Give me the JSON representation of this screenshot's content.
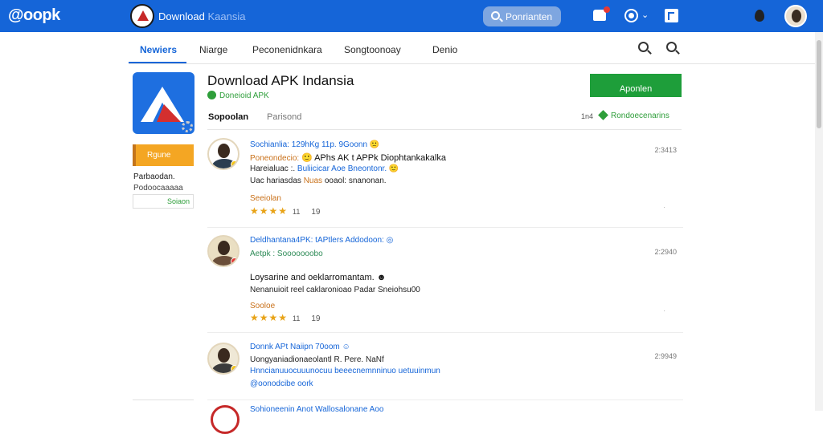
{
  "topbar": {
    "logo": "@oopk",
    "title": "Download",
    "title_faint": "Kaansia",
    "search_label": "Ponrianten"
  },
  "tabs": [
    {
      "label": "Newiers"
    },
    {
      "label": "Niarge"
    },
    {
      "label": "Peconenidnkara"
    },
    {
      "label": "Songtoonoay"
    },
    {
      "label": "Denio"
    }
  ],
  "sidebar": {
    "button_label": "Rgune",
    "name": "Parbaodan.",
    "sub": "Podoocaaaaa",
    "box_label": "Soiaon"
  },
  "app": {
    "title": "Download APK Indansia",
    "developer": "Doneioid APK",
    "install_label": "Aponlen",
    "subtab_active": "Sopoolan",
    "subtab_other": "Parisond",
    "count": "1n4",
    "recommend_label": "Rondoecenarins"
  },
  "reviews": [
    {
      "line1": "Sochianlia: 129hKg 11p. 9Goonn",
      "line1_emoji": "🙁",
      "line2_orange": "Poneondecio:",
      "line2_dark": "🙂 APhs AK t APPk Diophtankakalka",
      "line3_dark": "Hareialuac :.",
      "line3_blue": "Buliicicar Aoe Bneontonr.",
      "line3_emoji": "🙂",
      "line4_dark": "Uac hariasdas",
      "line4_orange": "Nuas",
      "line4_rest": "ooaol: snanonan.",
      "label": "Seeiolan",
      "rating": 4,
      "rating_text": "11",
      "count": "19",
      "time": "2:3413"
    },
    {
      "line1": "Deldhantana4PK: tAPtlers Addodoon:",
      "line1_emoji": "◎",
      "line2": "Aetpk : Sooooooobo",
      "line3": "Loysarine and oeklarromantam.",
      "line3_emoji": "☻",
      "line4": "Nenanuioit reel caklaronioao Padar Sneiohsu00",
      "label": "Sooloe",
      "rating": 4,
      "rating_text": "11",
      "count": "19",
      "time": "2:2940"
    },
    {
      "line1": "Donnk APt Naiipn 70oom",
      "line1_emoji": "☺",
      "line2": "Uongyaniadionaeolantl R. Pere. NaNf",
      "line3": "Hnncianuuocuuunocuu beeecnemnninuo uetuuinmun",
      "line4": "@oonodcibe oork",
      "time": "2:9949"
    }
  ],
  "bottom_review": {
    "line1": "Sohioneenin Anot Wallosalonane Aoo"
  }
}
